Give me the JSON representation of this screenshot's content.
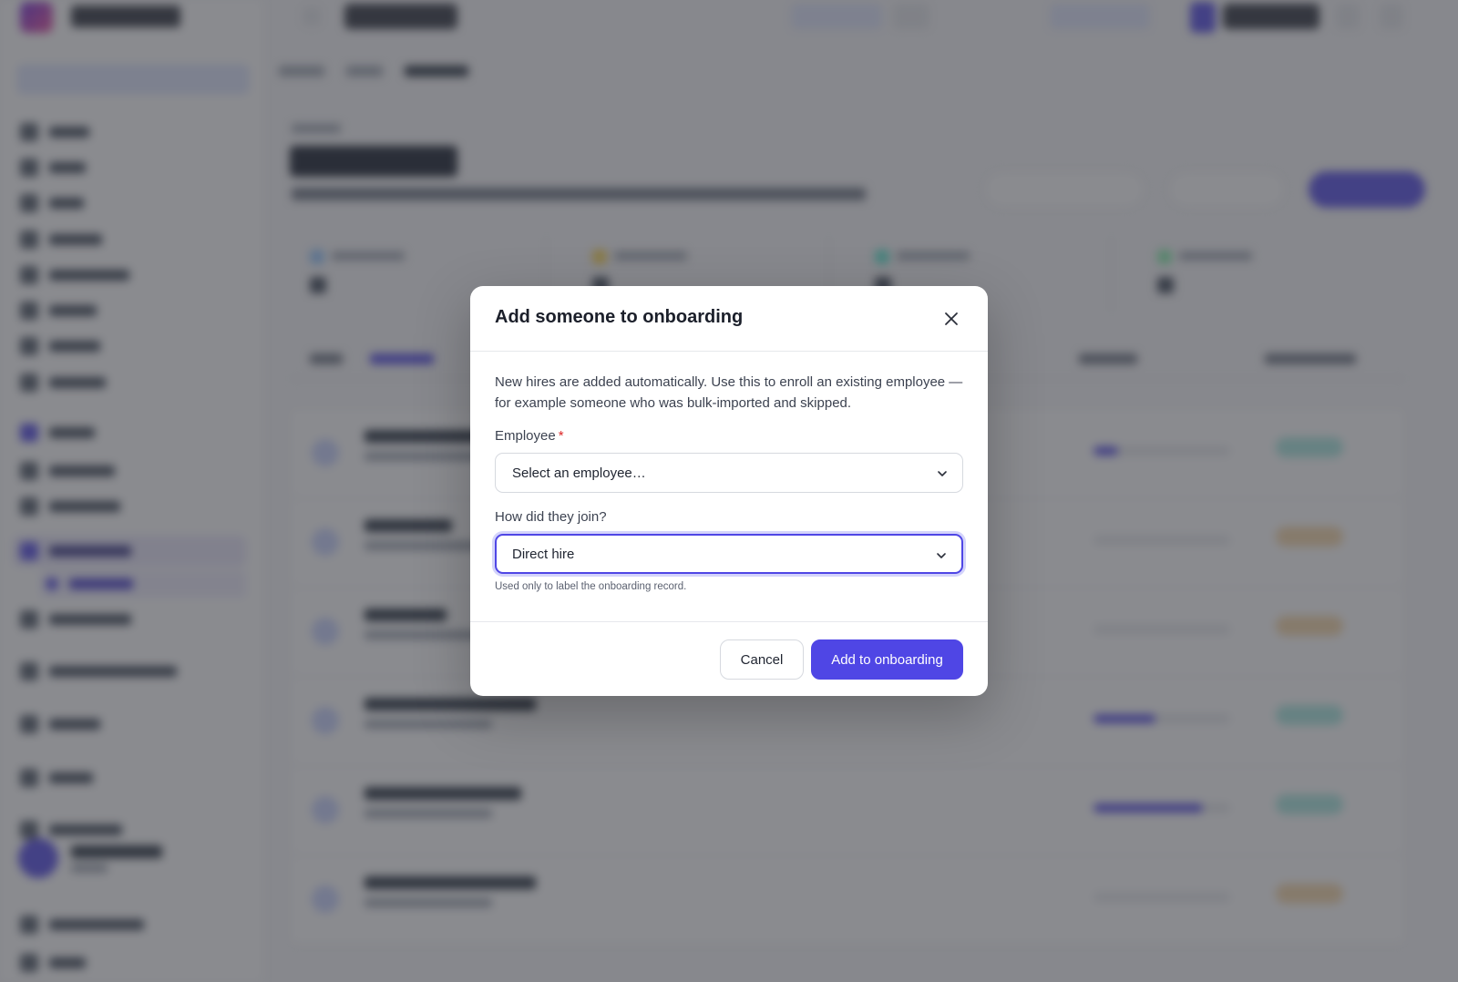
{
  "modal": {
    "title": "Add someone to onboarding",
    "description": "New hires are added automatically. Use this to enroll an existing employee — for example someone who was bulk-imported and skipped.",
    "employee_label": "Employee",
    "required_marker": "*",
    "employee_placeholder": "Select an employee…",
    "join_label": "How did they join?",
    "join_value": "Direct hire",
    "join_hint": "Used only to label the onboarding record.",
    "cancel_label": "Cancel",
    "submit_label": "Add to onboarding"
  },
  "icons": {
    "close": "close-icon",
    "dropdown": "chevron-down-icon"
  },
  "colors": {
    "accent": "#4f46e5",
    "required": "#dc2626",
    "scrim": "rgba(60,62,68,0.6)"
  }
}
